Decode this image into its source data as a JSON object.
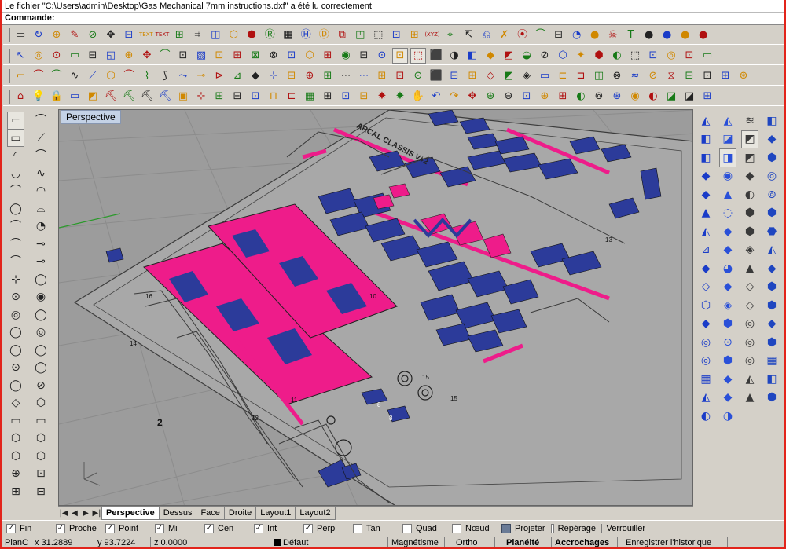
{
  "command_history": "Le fichier \"C:\\Users\\admin\\Desktop\\Gas Mechanical 7mm instructions.dxf\" a été lu correctement",
  "command_prompt": "Commande:",
  "toolbar_rows": [
    [
      "▭",
      "↻",
      "⊕",
      "✎",
      "⊘",
      "✥",
      "⊟",
      "TEXT",
      "TEXT",
      "⊞",
      "⌗",
      "◫",
      "⬡",
      "⬢",
      "Ⓡ",
      "▦",
      "Ⓗ",
      "Ⓓ",
      "⧉",
      "◰",
      "⬚",
      "⊡",
      "⊞",
      "(XYZ)",
      "⌖",
      "⇱",
      "⎌",
      "✗",
      "⦿",
      "⌒",
      "⊟",
      "◔",
      "●",
      "☠",
      "T",
      "●",
      "●",
      "●",
      "●"
    ],
    [
      "↖",
      "◎",
      "⊙",
      "▭",
      "⊟",
      "◱",
      "⊕",
      "✥",
      "⌒",
      "⊡",
      "▧",
      "⊡",
      "⊞",
      "⊠",
      "⊗",
      "⊡",
      "⬡",
      "⊞",
      "◉",
      "⊟",
      "⊙",
      "⊡",
      "⬚",
      "⬛",
      "◑",
      "◧",
      "◆",
      "◩",
      "◒",
      "⊘",
      "⬡",
      "✦",
      "⬢",
      "◐",
      "⬚",
      "⊡",
      "◎",
      "⊡",
      "▭"
    ],
    [
      "⌐",
      "⌒",
      "⌒",
      "∿",
      "⟋",
      "⬡",
      "⌒",
      "⌇",
      "⟆",
      "⤳",
      "⊸",
      "⊳",
      "⊿",
      "◆",
      "⊹",
      "⊟",
      "⊕",
      "⊞",
      "⋯",
      "⋯",
      "⊞",
      "⊡",
      "⊙",
      "⬛",
      "⊟",
      "⊞",
      "◇",
      "◩",
      "◈",
      "▭",
      "⊏",
      "⊐",
      "◫",
      "⊗",
      "≈",
      "⊘",
      "⧖",
      "⊟",
      "⊡",
      "⊞",
      "⊛"
    ],
    [
      "⌂",
      "💡",
      "🔒",
      "▭",
      "◩",
      "⛏",
      "⛏",
      "⛏",
      "⛏",
      "▣",
      "⊹",
      "⊞",
      "⊟",
      "⊡",
      "⊓",
      "⊏",
      "▦",
      "⊞",
      "⊡",
      "⊟",
      "✸",
      "✸",
      "✋",
      "↶",
      "↷",
      "✥",
      "⊕",
      "⊖",
      "⊡",
      "⊕",
      "⊞",
      "◐",
      "⊚",
      "⊛",
      "◉",
      "◐",
      "◪",
      "◪",
      "⊞"
    ]
  ],
  "left_tools": [
    "⌐",
    "⌒",
    "▭",
    "⟋",
    "◜",
    "⌒",
    "◡",
    "∿",
    "⌒",
    "◠",
    "◯",
    "⌓",
    "⌒",
    "◔",
    "⌒",
    "⊸",
    "⌒",
    "⊸",
    "⊹",
    "◯",
    "⊙",
    "◉",
    "◎",
    "◯",
    "◯",
    "◎",
    "◯",
    "◯",
    "⊙",
    "◯",
    "◯",
    "⊘",
    "◇",
    "⬡",
    "▭",
    "▭",
    "⬡",
    "⬡",
    "⬡",
    "⬡",
    "⊕",
    "⊡",
    "⊞",
    "⊟"
  ],
  "right_tools": [
    "◭",
    "◭",
    "≋",
    "◧",
    "◧",
    "◪",
    "◩",
    "◆",
    "◧",
    "◨",
    "◩",
    "⬢",
    "◆",
    "◉",
    "◆",
    "◎",
    "◆",
    "▲",
    "◐",
    "⊚",
    "▲",
    "◌",
    "⬢",
    "⬢",
    "◭",
    "◆",
    "⬢",
    "⬣",
    "⊿",
    "◆",
    "◈",
    "◭",
    "◆",
    "◕",
    "▲",
    "◆",
    "◇",
    "◆",
    "◇",
    "⬢",
    "⬡",
    "◈",
    "◇",
    "⬢",
    "◆",
    "⬢",
    "◎",
    "◆",
    "◎",
    "⊙",
    "◎",
    "⬢",
    "◎",
    "⬢",
    "◎",
    "▦",
    "▦",
    "◆",
    "◭",
    "◧",
    "◭",
    "◆",
    "▲",
    "⬢",
    "◐",
    "◑"
  ],
  "viewport": {
    "title": "Perspective",
    "labels": [
      "ARCAL CLASSIS V#2",
      "2",
      "10",
      "11",
      "12",
      "13",
      "14",
      "15",
      "15",
      "16",
      "8",
      "8"
    ]
  },
  "view_tabs": {
    "nav": [
      "|◀",
      "◀",
      "▶",
      "▶|"
    ],
    "items": [
      "Perspective",
      "Dessus",
      "Face",
      "Droite",
      "Layout1",
      "Layout2"
    ],
    "active": "Perspective"
  },
  "osnaps": [
    {
      "label": "Fin",
      "checked": true
    },
    {
      "label": "Proche",
      "checked": true
    },
    {
      "label": "Point",
      "checked": true
    },
    {
      "label": "Mi",
      "checked": true
    },
    {
      "label": "Cen",
      "checked": true
    },
    {
      "label": "Int",
      "checked": true
    },
    {
      "label": "Perp",
      "checked": true
    },
    {
      "label": "Tan",
      "checked": false
    },
    {
      "label": "Quad",
      "checked": false
    },
    {
      "label": "Nœud",
      "checked": false
    },
    {
      "label": "Projeter",
      "checked": false,
      "style": "square"
    },
    {
      "label": "Repérage",
      "checked": false
    },
    {
      "label": "Verrouiller",
      "checked": false
    }
  ],
  "status": {
    "plane": "PlanC",
    "x": "x 31.2889",
    "y": "y 93.7224",
    "z": "z 0.0000",
    "layer": "Défaut",
    "magnetisme": "Magnétisme",
    "ortho": "Ortho",
    "planeite": "Planéité",
    "accrochages": "Accrochages",
    "history": "Enregistrer l'historique"
  },
  "colors": {
    "viewport_bg": "#9c9c9c",
    "part_pink": "#ee1c8a",
    "part_blue": "#2c3b9a",
    "frame_red": "#e2241b"
  }
}
